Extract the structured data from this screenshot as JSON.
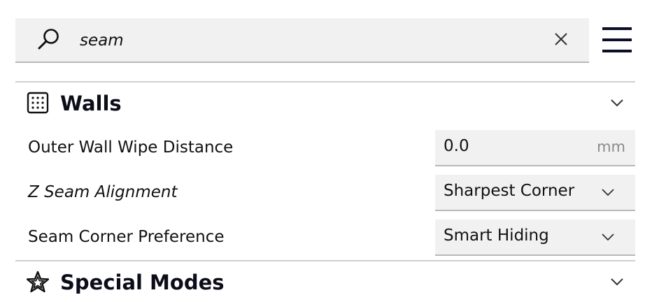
{
  "search": {
    "value": "seam",
    "icon": "search-icon"
  },
  "categories": [
    {
      "title": "Walls",
      "icon": "walls-grid-icon",
      "settings": [
        {
          "label": "Outer Wall Wipe Distance",
          "value": "0.0",
          "unit": "mm",
          "type": "number"
        },
        {
          "label": "Z Seam Alignment",
          "value": "Sharpest Corner",
          "type": "dropdown"
        },
        {
          "label": "Seam Corner Preference",
          "value": "Smart Hiding",
          "type": "dropdown"
        }
      ]
    },
    {
      "title": "Special Modes",
      "icon": "star-icon"
    }
  ],
  "colors": {
    "field_bg": "#f1f1f1",
    "title": "#0d0d1a",
    "unit": "#8a8a8a"
  }
}
